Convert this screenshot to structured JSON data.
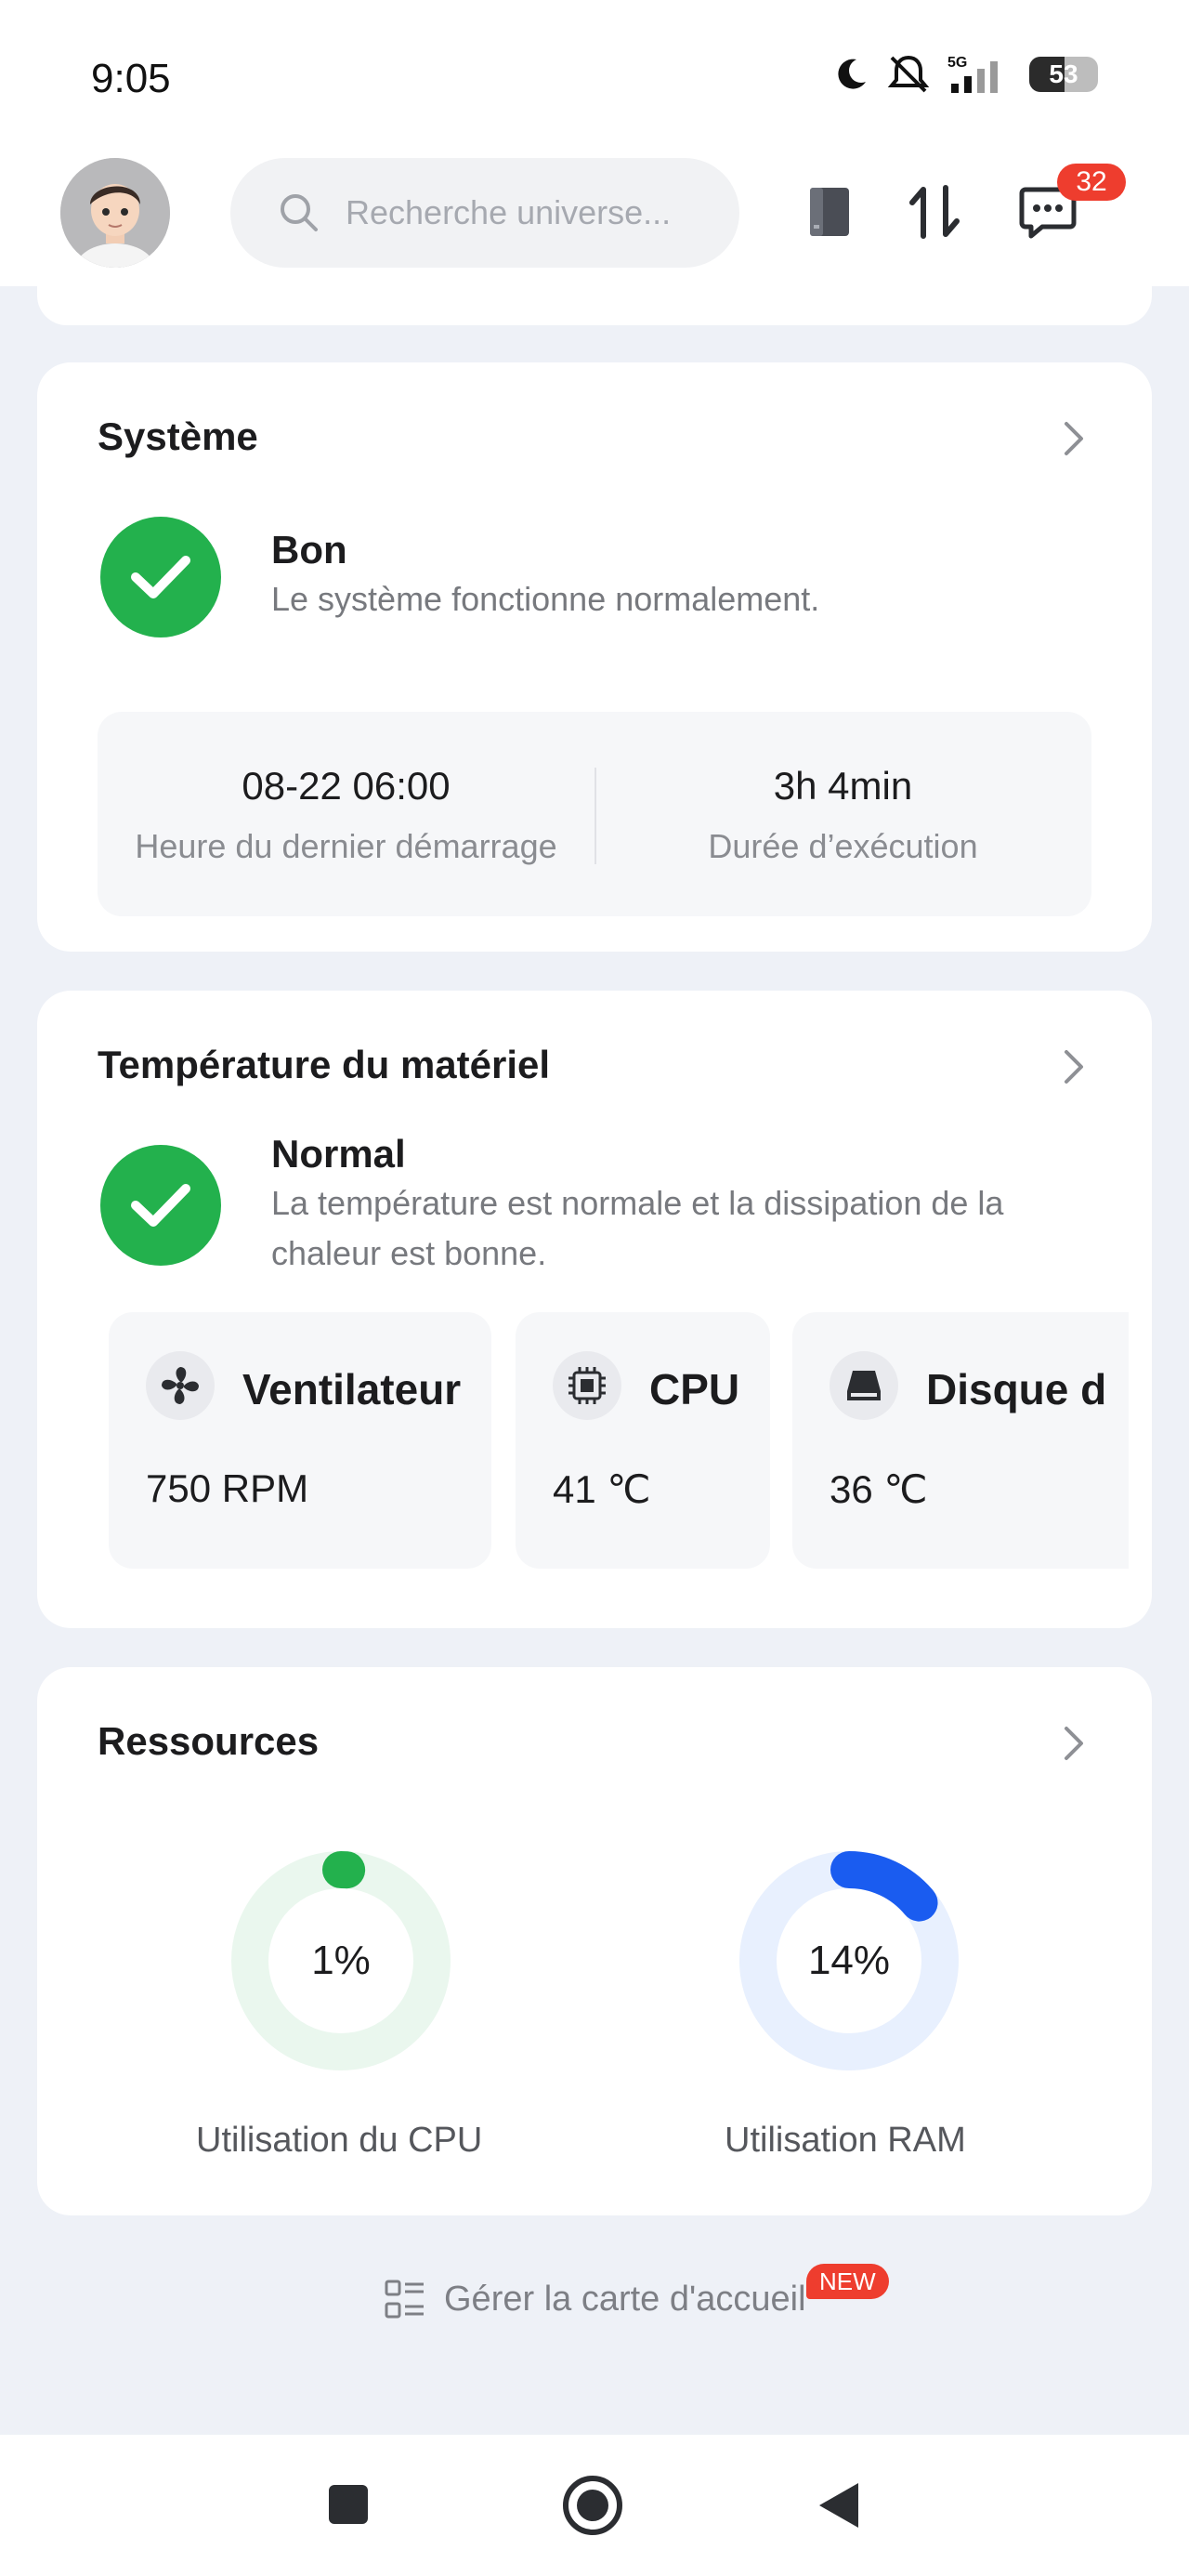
{
  "status_bar": {
    "time": "9:05",
    "battery": "53",
    "network": "5G"
  },
  "header": {
    "search_placeholder": "Recherche universe...",
    "messages_badge": "32",
    "icons": [
      "avatar",
      "search-icon",
      "nas-device-icon",
      "transfer-icon",
      "message-icon"
    ]
  },
  "system_card": {
    "title": "Système",
    "status_title": "Bon",
    "status_desc": "Le système fonctionne normalement.",
    "last_boot_value": "08-22 06:00",
    "last_boot_label": "Heure du dernier démarrage",
    "uptime_value": "3h 4min",
    "uptime_label": "Durée d’exécution"
  },
  "temperature_card": {
    "title": "Température du matériel",
    "status_title": "Normal",
    "status_desc": "La température est normale et la dissipation de la chaleur est bonne.",
    "items": [
      {
        "name": "Ventilateur",
        "value": "750 RPM",
        "icon": "fan-icon"
      },
      {
        "name": "CPU",
        "value": "41 ℃",
        "icon": "cpu-chip-icon"
      },
      {
        "name": "Disque d",
        "value": "36 ℃",
        "icon": "disk-icon"
      }
    ]
  },
  "resources_card": {
    "title": "Ressources",
    "cpu": {
      "value": "1%",
      "percent": 1,
      "label": "Utilisation du CPU",
      "color": "#23b14d",
      "track": "#eaf7ee"
    },
    "ram": {
      "value": "14%",
      "percent": 14,
      "label": "Utilisation RAM",
      "color": "#1a5cf0",
      "track": "#e8f0fe"
    }
  },
  "manage_home": {
    "label": "Gérer la carte d'accueil",
    "badge": "NEW"
  },
  "nav": {
    "buttons": [
      "recents-button",
      "home-button",
      "back-button"
    ]
  }
}
